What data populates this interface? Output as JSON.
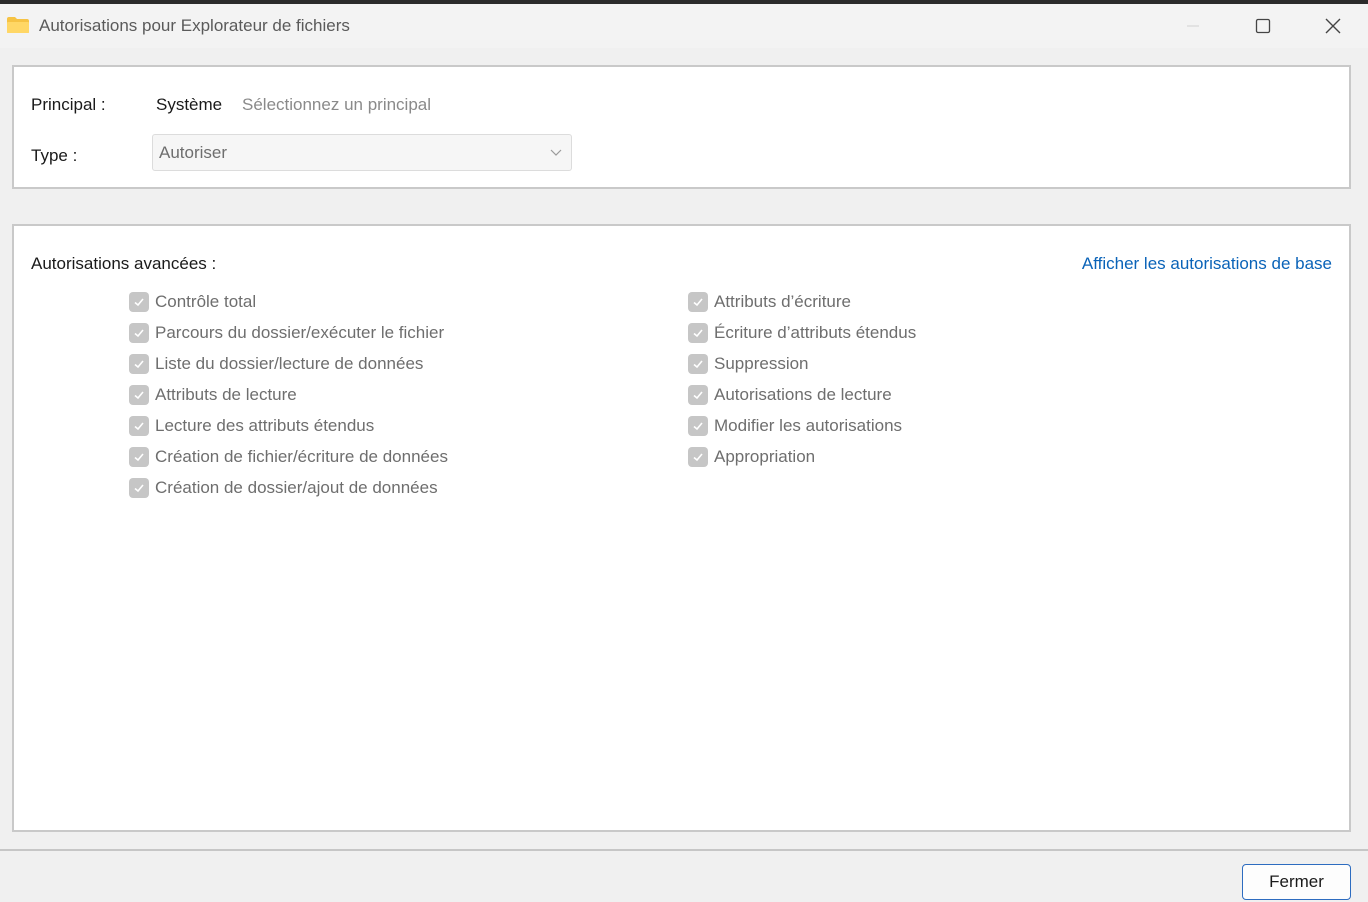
{
  "window": {
    "title": "Autorisations pour Explorateur de fichiers"
  },
  "principal": {
    "label": "Principal :",
    "value": "Système",
    "action": "Sélectionnez un principal"
  },
  "type": {
    "label": "Type :",
    "selected": "Autoriser"
  },
  "advanced": {
    "heading": "Autorisations avancées :",
    "show_basic_link": "Afficher les autorisations de base",
    "left_column": [
      {
        "label": "Contrôle total",
        "checked": true
      },
      {
        "label": "Parcours du dossier/exécuter le fichier",
        "checked": true
      },
      {
        "label": "Liste du dossier/lecture de données",
        "checked": true
      },
      {
        "label": "Attributs de lecture",
        "checked": true
      },
      {
        "label": "Lecture des attributs étendus",
        "checked": true
      },
      {
        "label": "Création de fichier/écriture de données",
        "checked": true
      },
      {
        "label": "Création de dossier/ajout de données",
        "checked": true
      }
    ],
    "right_column": [
      {
        "label": "Attributs d’écriture",
        "checked": true
      },
      {
        "label": "Écriture d’attributs étendus",
        "checked": true
      },
      {
        "label": "Suppression",
        "checked": true
      },
      {
        "label": "Autorisations de lecture",
        "checked": true
      },
      {
        "label": "Modifier les autorisations",
        "checked": true
      },
      {
        "label": "Appropriation",
        "checked": true
      }
    ]
  },
  "footer": {
    "close_label": "Fermer"
  },
  "colors": {
    "accent": "#0a63b8",
    "checkbox_disabled": "#c6c6c6"
  }
}
